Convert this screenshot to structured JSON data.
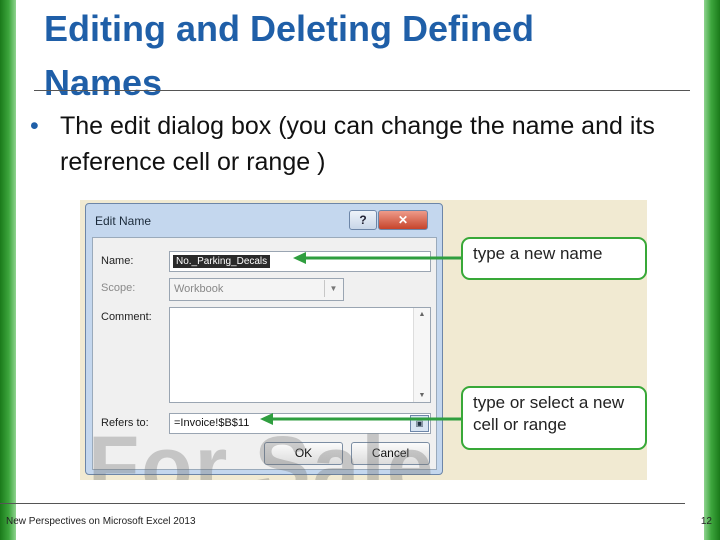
{
  "slide": {
    "title": "Editing and Deleting Defined Names",
    "bullet_symbol": "•",
    "bullet": "The edit dialog box (you can change the name and its reference cell or range )",
    "footer": "New Perspectives on Microsoft Excel 2013",
    "page_number": "12"
  },
  "dialog": {
    "title": "Edit Name",
    "help_label": "?",
    "close_label": "✕",
    "name_label": "Name:",
    "name_value": "No._Parking_Decals",
    "scope_label": "Scope:",
    "scope_value": "Workbook",
    "comment_label": "Comment:",
    "comment_value": "",
    "refers_label": "Refers to:",
    "refers_value": "=Invoice!$B$11",
    "ok_label": "OK",
    "cancel_label": "Cancel"
  },
  "callouts": {
    "name": "type a new name",
    "refers": "type or select a new cell or range"
  },
  "watermark": "For Sale",
  "icons": {
    "scope_dropdown": "chevron-down-icon",
    "comment_scroll_up": "scroll-up-icon",
    "comment_scroll_down": "scroll-down-icon",
    "collapse": "collapse-dialog-icon"
  },
  "colors": {
    "title": "#1f5fa8",
    "accent_green": "#38a838",
    "arrow_green": "#2f9e3f"
  }
}
